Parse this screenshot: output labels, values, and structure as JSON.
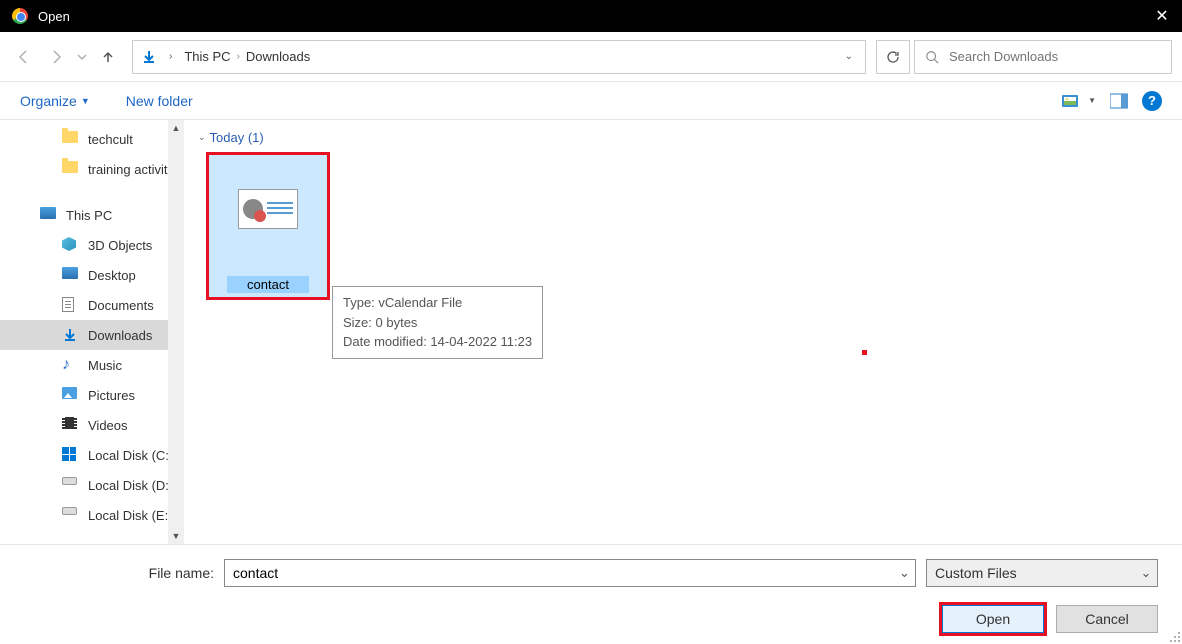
{
  "window": {
    "title": "Open"
  },
  "nav": {
    "breadcrumbs": [
      "This PC",
      "Downloads"
    ],
    "search_placeholder": "Search Downloads"
  },
  "toolbar": {
    "organize": "Organize",
    "new_folder": "New folder"
  },
  "sidebar": {
    "items": [
      {
        "key": "techcult",
        "label": "techcult",
        "icon": "folder",
        "indent": "sub"
      },
      {
        "key": "training",
        "label": "training activities",
        "icon": "folder",
        "indent": "sub"
      },
      {
        "key": "thispc",
        "label": "This PC",
        "icon": "pc",
        "indent": "top",
        "spacer_before": true
      },
      {
        "key": "3dobj",
        "label": "3D Objects",
        "icon": "obj3d",
        "indent": "sub"
      },
      {
        "key": "desktop",
        "label": "Desktop",
        "icon": "pc",
        "indent": "sub"
      },
      {
        "key": "documents",
        "label": "Documents",
        "icon": "doc",
        "indent": "sub"
      },
      {
        "key": "downloads",
        "label": "Downloads",
        "icon": "download",
        "indent": "sub",
        "active": true
      },
      {
        "key": "music",
        "label": "Music",
        "icon": "music",
        "indent": "sub"
      },
      {
        "key": "pictures",
        "label": "Pictures",
        "icon": "pic",
        "indent": "sub"
      },
      {
        "key": "videos",
        "label": "Videos",
        "icon": "vid",
        "indent": "sub"
      },
      {
        "key": "diskc",
        "label": "Local Disk (C:)",
        "icon": "win",
        "indent": "sub"
      },
      {
        "key": "diskd",
        "label": "Local Disk (D:)",
        "icon": "disk",
        "indent": "sub"
      },
      {
        "key": "diske",
        "label": "Local Disk (E:)",
        "icon": "disk",
        "indent": "sub"
      }
    ]
  },
  "content": {
    "group": "Today (1)",
    "file": {
      "name": "contact"
    },
    "tooltip": {
      "line1": "Type: vCalendar File",
      "line2": "Size: 0 bytes",
      "line3": "Date modified: 14-04-2022 11:23"
    }
  },
  "footer": {
    "filename_label": "File name:",
    "filename_value": "contact",
    "filter": "Custom Files",
    "open": "Open",
    "cancel": "Cancel"
  }
}
